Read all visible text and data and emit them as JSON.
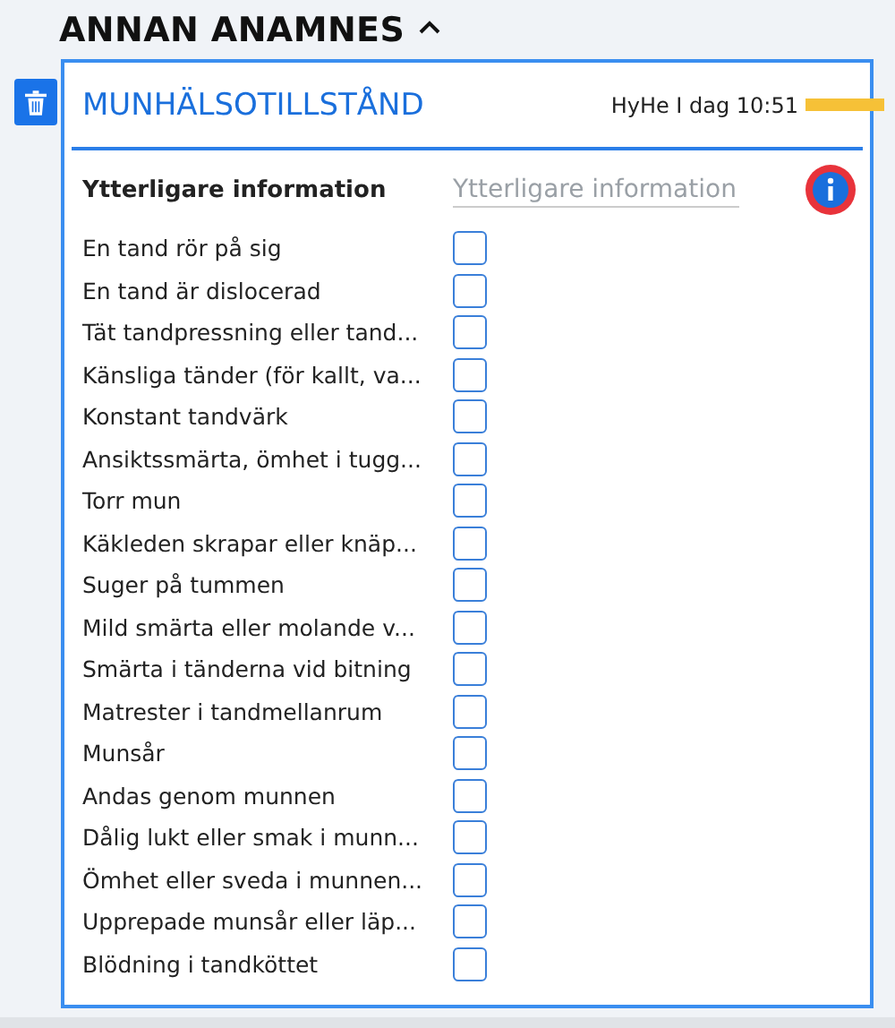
{
  "section": {
    "title": "ANNAN ANAMNES",
    "expanded": true
  },
  "card": {
    "title": "MUNHÄLSOTILLSTÅND",
    "meta": "HyHe I dag 10:51",
    "info_field": {
      "label": "Ytterligare information",
      "placeholder": "Ytterligare information"
    },
    "items": [
      {
        "label": "En tand rör på sig",
        "checked": false
      },
      {
        "label": "En tand är dislocerad",
        "checked": false
      },
      {
        "label": "Tät tandpressning eller tand...",
        "checked": false
      },
      {
        "label": "Känsliga tänder (för kallt, va...",
        "checked": false
      },
      {
        "label": "Konstant tandvärk",
        "checked": false
      },
      {
        "label": "Ansiktssmärta, ömhet i tugg...",
        "checked": false
      },
      {
        "label": "Torr mun",
        "checked": false
      },
      {
        "label": "Käkleden skrapar eller knäp...",
        "checked": false
      },
      {
        "label": "Suger på tummen",
        "checked": false
      },
      {
        "label": "Mild smärta eller molande v...",
        "checked": false
      },
      {
        "label": "Smärta i tänderna vid bitning",
        "checked": false
      },
      {
        "label": "Matrester i tandmellanrum",
        "checked": false
      },
      {
        "label": "Munsår",
        "checked": false
      },
      {
        "label": "Andas genom munnen",
        "checked": false
      },
      {
        "label": "Dålig lukt eller smak i munn...",
        "checked": false
      },
      {
        "label": "Ömhet eller sveda i munnen...",
        "checked": false
      },
      {
        "label": "Upprepade munsår eller läp...",
        "checked": false
      },
      {
        "label": "Blödning i tandköttet",
        "checked": false
      }
    ]
  }
}
